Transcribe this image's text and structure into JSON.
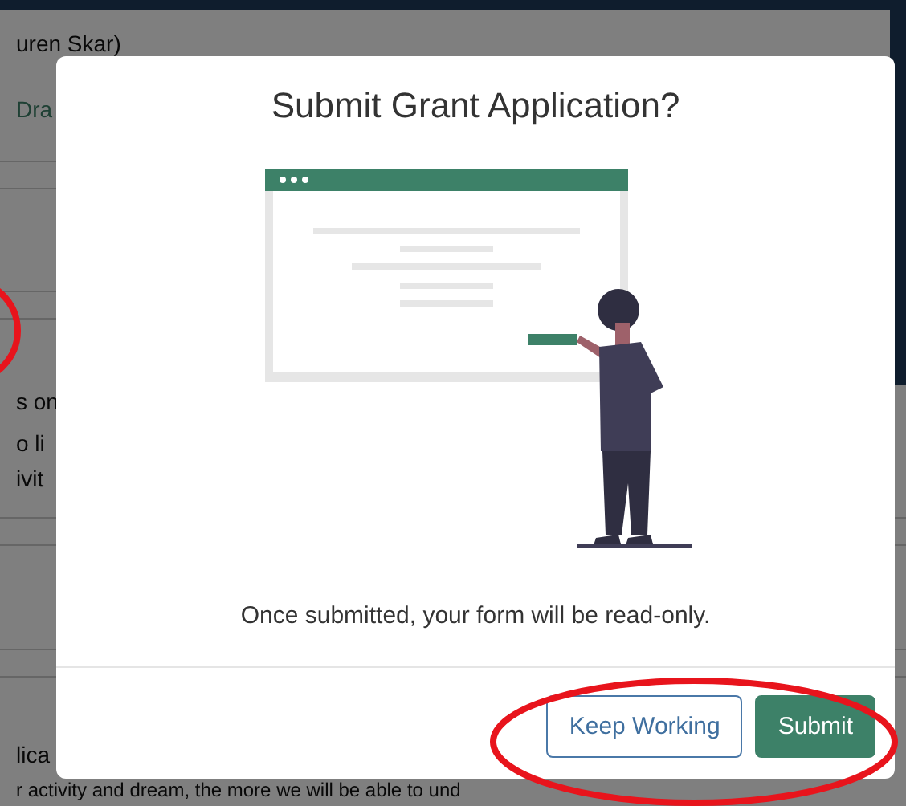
{
  "background_page": {
    "texts": [
      {
        "text": "uren Skar)",
        "kind": "plain"
      },
      {
        "text": "Dra",
        "kind": "link"
      },
      {
        "text": "s on",
        "kind": "plain"
      },
      {
        "text": "o li",
        "kind": "plain"
      },
      {
        "text": "ivit",
        "kind": "plain"
      },
      {
        "text": "lica",
        "kind": "plain"
      },
      {
        "text": "r activity and dream, the more we will be able to und",
        "kind": "plain"
      }
    ]
  },
  "dialog": {
    "title": "Submit Grant Application?",
    "message": "Once submitted, your form will be read-only.",
    "buttons": [
      {
        "label": "Keep Working",
        "kind": "secondary"
      },
      {
        "label": "Submit",
        "kind": "primary"
      }
    ]
  }
}
